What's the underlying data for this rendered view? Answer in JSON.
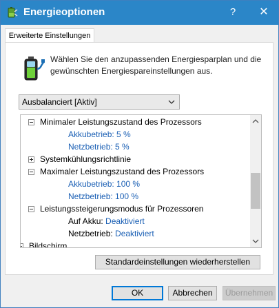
{
  "window": {
    "title": "Energieoptionen",
    "help_label": "?",
    "close_label": "✕"
  },
  "tab": {
    "label": "Erweiterte Einstellungen"
  },
  "intro": {
    "line1": "Wählen Sie den anzupassenden Energiesparplan und die",
    "line2": "gewünschten Energiespareinstellungen aus."
  },
  "plan_select": {
    "value": "Ausbalanciert [Aktiv]"
  },
  "tree": {
    "min_state": {
      "label": "Minimaler Leistungszustand des Prozessors",
      "battery_label": "Akkubetrieb: 5 %",
      "ac_label": "Netzbetrieb: 5 %"
    },
    "cooling": {
      "label": "Systemkühlungsrichtlinie"
    },
    "max_state": {
      "label": "Maximaler Leistungszustand des Prozessors",
      "battery_label": "Akkubetrieb: 100 %",
      "ac_label": "Netzbetrieb: 100 %"
    },
    "boost": {
      "label": "Leistungssteigerungsmodus für Prozessoren",
      "battery_label": "Auf Akku:",
      "battery_value": "Deaktiviert",
      "ac_label": "Netzbetrieb:",
      "ac_value": "Deaktiviert"
    },
    "display": {
      "label": "Bildschirm"
    }
  },
  "buttons": {
    "restore": "Standardeinstellungen wiederherstellen",
    "ok": "OK",
    "cancel": "Abbrechen",
    "apply": "Übernehmen"
  },
  "icons": {
    "title": "battery-plug-icon",
    "intro": "battery-plug-icon",
    "select": "chevron-down-icon",
    "scroll_up": "scroll-up-icon",
    "scroll_down": "scroll-down-icon"
  },
  "colors": {
    "titlebar": "#2b86c8",
    "link": "#1a5fb4",
    "ok_border": "#0078d7"
  }
}
